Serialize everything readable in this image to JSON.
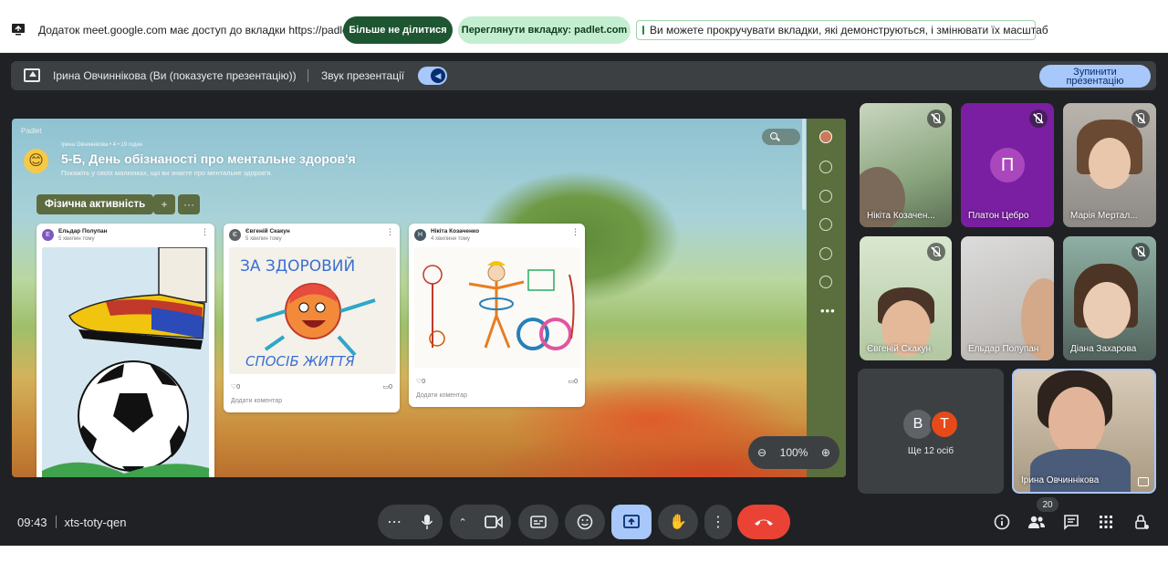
{
  "share_bar": {
    "message": "Додаток meet.google.com має доступ до вкладки https://padlet.com",
    "stop_sharing_label": "Більше не ділитися",
    "view_tab_label": "Переглянути вкладку: padlet.com",
    "info_text": "Ви можете прокручувати вкладки, які демонструються, і змінювати їх масштаб"
  },
  "presenting_bar": {
    "presenter": "Ірина Овчиннікова (Ви (показуєте презентацію))",
    "sound_label": "Звук презентації",
    "sound_on": true,
    "stop_label_line1": "Зупинити",
    "stop_label_line2": "презентацію"
  },
  "padlet": {
    "logo": "Padlet",
    "emoji": "😊",
    "author_line": "Ірина Овчиннікова • 4 • 19 годин",
    "title": "5-Б, День обізнаності про ментальне здоров'я",
    "subtitle": "Покажіть у своїх малюнках, що ви знаєте про ментальне здоров'я.",
    "section": "Фізична активність",
    "add_label": "+",
    "more_label": "···",
    "posts": [
      {
        "initial": "Е",
        "author": "Ельдар Полупан",
        "time": "5 хвилин тому",
        "color": "#7e57c2"
      },
      {
        "initial": "Є",
        "author": "Євгеній Скакун",
        "time": "5 хвилин тому",
        "color": "#5f6368",
        "likes": "0",
        "comments": "0",
        "add_comment": "Додати коментар",
        "drawing_text_top": "ЗА ЗДОРОВИЙ",
        "drawing_text_bottom": "СПОСІБ ЖИТТЯ"
      },
      {
        "initial": "Н",
        "author": "Нікіта Козаченко",
        "time": "4 хвилини тому",
        "color": "#455a64",
        "likes": "0",
        "comments": "0",
        "add_comment": "Додати коментар"
      }
    ],
    "zoom_value": "100%"
  },
  "participants": [
    {
      "name": "Нікіта Козачен...",
      "muted": true
    },
    {
      "name": "Платон Цебро",
      "muted": true,
      "initial": "П",
      "color": "#8e24aa"
    },
    {
      "name": "Марія Мертал...",
      "muted": true
    },
    {
      "name": "Євгеній Скакун",
      "muted": true
    },
    {
      "name": "Ельдар Полупан",
      "muted": false
    },
    {
      "name": "Діана Захарова",
      "muted": true
    }
  ],
  "others_tile": {
    "avatar1": "В",
    "avatar2": "Т",
    "label": "Ще 12 осіб",
    "color1": "#5f6368",
    "color2": "#e64a19"
  },
  "self_tile": {
    "name": "Ірина Овчиннікова"
  },
  "bottom_bar": {
    "time": "09:43",
    "meeting_code": "xts-toty-qen",
    "participants_count": "20",
    "icons": [
      "more-icon",
      "mic-icon",
      "chevron-up-icon",
      "camera-icon",
      "captions-icon",
      "emoji-icon",
      "present-icon",
      "raise-hand-icon",
      "more-vert-icon",
      "hang-up-icon",
      "info-icon",
      "people-icon",
      "chat-icon",
      "apps-icon",
      "host-controls-icon"
    ]
  },
  "colors": {
    "meet_bg": "#202124",
    "accent_blue": "#a8c7fa",
    "hangup_red": "#ea4335",
    "present_active": "#a8c7fa",
    "share_green": "#1e5631"
  }
}
